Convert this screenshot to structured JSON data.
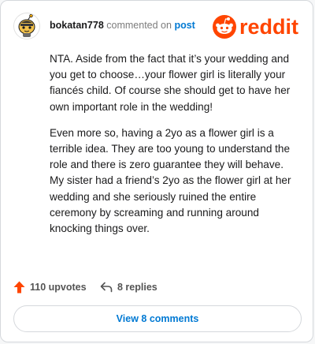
{
  "comment": {
    "username": "bokatan778",
    "action_text": "commented on",
    "post_link": "post",
    "paragraphs": [
      "NTA. Aside from the fact that it’s your wedding and you get to choose…your flower girl is literally your fiancés child. Of course she should get to have her own important role in the wedding!",
      "Even more so, having a 2yo as a flower girl is a terrible idea. They are too young to understand the role and there is zero guarantee they will behave. My sister had a friend’s 2yo as the flower girl at her wedding and she seriously ruined the entire ceremony by screaming and running around knocking things over."
    ]
  },
  "brand": {
    "logo_text": "reddit",
    "color": "#ff4500"
  },
  "actions": {
    "upvotes": "110 upvotes",
    "replies": "8 replies"
  },
  "view_button": {
    "label": "View 8 comments"
  },
  "icons": {
    "avatar": "snoo-avatar",
    "upvote": "upvote-arrow-icon",
    "reply": "reply-arrow-icon"
  }
}
